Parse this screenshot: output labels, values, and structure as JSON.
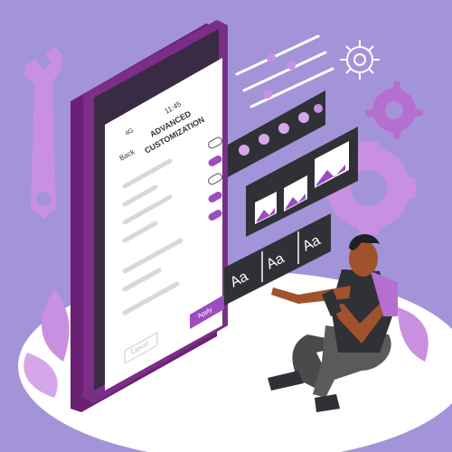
{
  "phone": {
    "status_time": "11:45",
    "status_network": "4G",
    "back_label": "Back",
    "title_line1": "ADVANCED",
    "title_line2": "CUSTOMIZATION",
    "apply_label": "Apply",
    "cancel_label": "Cancel"
  },
  "font_options": {
    "option1": "Aa",
    "option2": "Aa",
    "option3": "Aa"
  },
  "colors": {
    "background": "#a394d9",
    "accent": "#9b4dbf",
    "accent_light": "#d6a6ea",
    "phone_body": "#7b2e86",
    "panel_dark": "#2f3136"
  },
  "icons": [
    "wrench-icon",
    "gear-icon",
    "slider-lines-icon",
    "image-icon",
    "leaf-icon"
  ]
}
